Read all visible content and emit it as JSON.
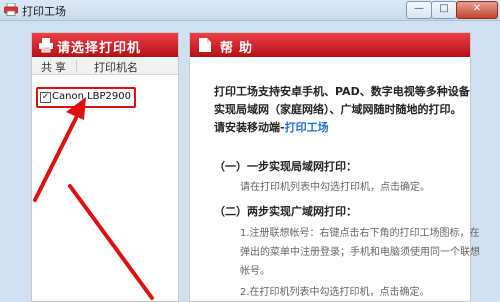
{
  "window": {
    "title": "打印工场",
    "minimize_glyph": "—",
    "maximize_glyph": "□",
    "close_glyph": "✕"
  },
  "left_panel": {
    "title": "请选择打印机",
    "columns": [
      "共享",
      "打印机名"
    ],
    "printers": [
      {
        "checked": true,
        "check_glyph": "✓",
        "name": "Canon LBP2900"
      }
    ]
  },
  "help": {
    "title": "帮助",
    "intro_lines": [
      "打印工场支持安卓手机、PAD、数字电视等多种设备",
      "实现局域网（家庭网络）、广域网随时随地的打印。"
    ],
    "install_prefix": "请安装移动端-",
    "install_link": "打印工场",
    "step1_title": "（一）一步实现局域网打印：",
    "step1_note": "请在打印机列表中勾选打印机，点击确定。",
    "step2_title": "（二）两步实现广域网打印：",
    "step2_notes": [
      "1.注册联想帐号：右键点击右下角的打印工场图标，在",
      "弹出的菜单中注册登录；手机和电脑须使用同一个联想",
      "帐号。",
      "2.在打印机列表中勾选打印机，点击确定。"
    ]
  },
  "colors": {
    "header_red": "#c8161d",
    "highlight_red": "#e01010",
    "link_blue": "#1e6fd0",
    "window_bg": "#cfe0f0"
  }
}
